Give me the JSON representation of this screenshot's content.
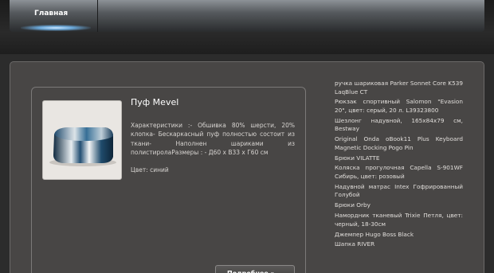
{
  "nav": {
    "items": [
      {
        "label": "Главная"
      }
    ]
  },
  "product": {
    "title": "Пуф Mevel",
    "description": "Характеристики :- Обшивка 80% шерсти, 20% клопка- Бескаркасный пуф полностью состоит из ткани- Наполнен шариками из полистиролаРазмеры : - Д60 х В33 х Г60 см",
    "color": "Цвет: синий",
    "more_button": "Подробнее »",
    "image_icon": "pouf-image"
  },
  "sidebar": {
    "links": [
      "ручка шариковая Parker Sonnet Core K539 LaqBlue CT",
      "Рюкзак спортивный Salomon \"Evasion 20\", цвет: серый, 20 л. L39323800",
      "Шезлонг надувной, 165х84х79 см, Bestway",
      "Original Onda oBook11 Plus Keyboard Magnetic Docking Pogo Pin",
      "Брюки VILATTE",
      "Коляска прогулочная Capella S-901WF Сибирь, цвет: розовый",
      "Надувной матрас Intex Гофрированный Голубой",
      "Брюки Orby",
      "Намордник тканевый Trixie Петля, цвет: черный, 18-30см",
      "Джемпер Hugo Boss Black",
      "Шапка RIVER"
    ]
  },
  "colors": {
    "background": "#2c2c2c",
    "panel": "#484645",
    "nav_gradient_top": "#8d9297",
    "nav_active_glow": "#6aa7d8"
  }
}
